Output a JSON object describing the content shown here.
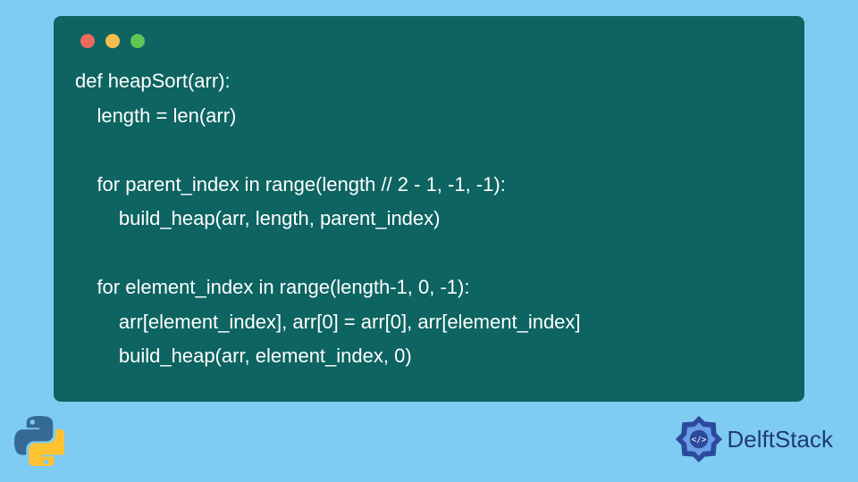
{
  "code": {
    "lines": [
      "def heapSort(arr):",
      "    length = len(arr)",
      "",
      "    for parent_index in range(length // 2 - 1, -1, -1):",
      "        build_heap(arr, length, parent_index)",
      "",
      "    for element_index in range(length-1, 0, -1):",
      "        arr[element_index], arr[0] = arr[0], arr[element_index]",
      "        build_heap(arr, element_index, 0)"
    ]
  },
  "brand": {
    "name": "DelftStack"
  },
  "colors": {
    "background": "#7fccf2",
    "code_bg": "#0d6461",
    "code_text": "#ffffff",
    "brand_text": "#1f3a78"
  }
}
